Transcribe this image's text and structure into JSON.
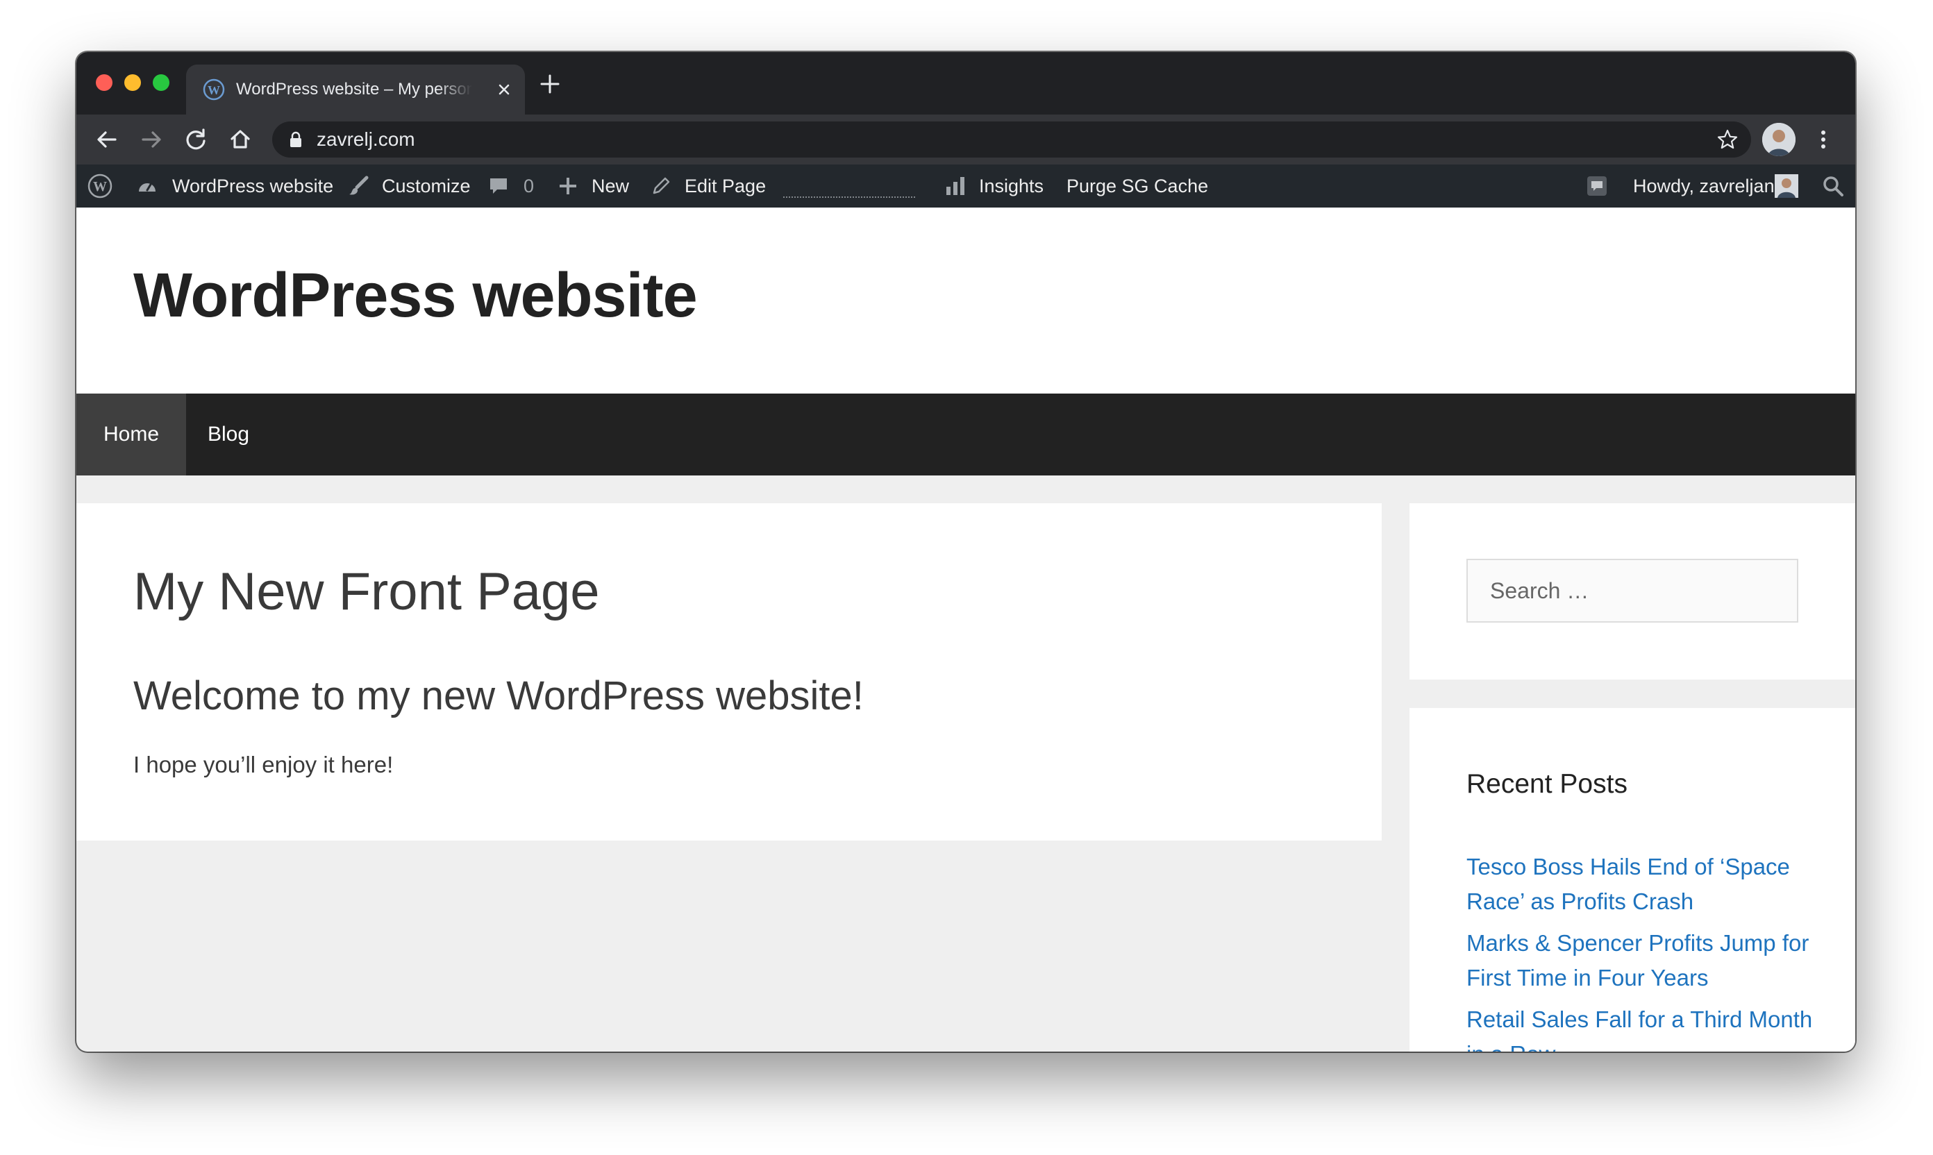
{
  "browser": {
    "tab": {
      "title": "WordPress website – My personal website",
      "favicon": "wordpress-icon"
    },
    "url": "zavrelj.com",
    "colors": {
      "chrome_dark": "#202124",
      "chrome_mid": "#35363a"
    }
  },
  "admin_bar": {
    "site_name": "WordPress website",
    "customize": "Customize",
    "comments_count": "0",
    "new": "New",
    "edit_page": "Edit Page",
    "insights": "Insights",
    "purge_cache": "Purge SG Cache",
    "howdy": "Howdy, zavreljan",
    "colors": {
      "background": "#23282d",
      "text": "#eeeeee"
    }
  },
  "site": {
    "title": "WordPress website",
    "nav": [
      {
        "label": "Home",
        "active": true
      },
      {
        "label": "Blog",
        "active": false
      }
    ]
  },
  "page": {
    "title": "My New Front Page",
    "subtitle": "Welcome to my new WordPress website!",
    "text": "I hope you’ll enjoy it here!"
  },
  "sidebar": {
    "search_placeholder": "Search …",
    "recent_posts_heading": "Recent Posts",
    "recent_posts": [
      "Tesco Boss Hails End of ‘Space Race’ as Profits Crash",
      "Marks & Spencer Profits Jump for First Time in Four Years",
      "Retail Sales Fall for a Third Month in a Row"
    ],
    "colors": {
      "link": "#1e73be"
    }
  }
}
